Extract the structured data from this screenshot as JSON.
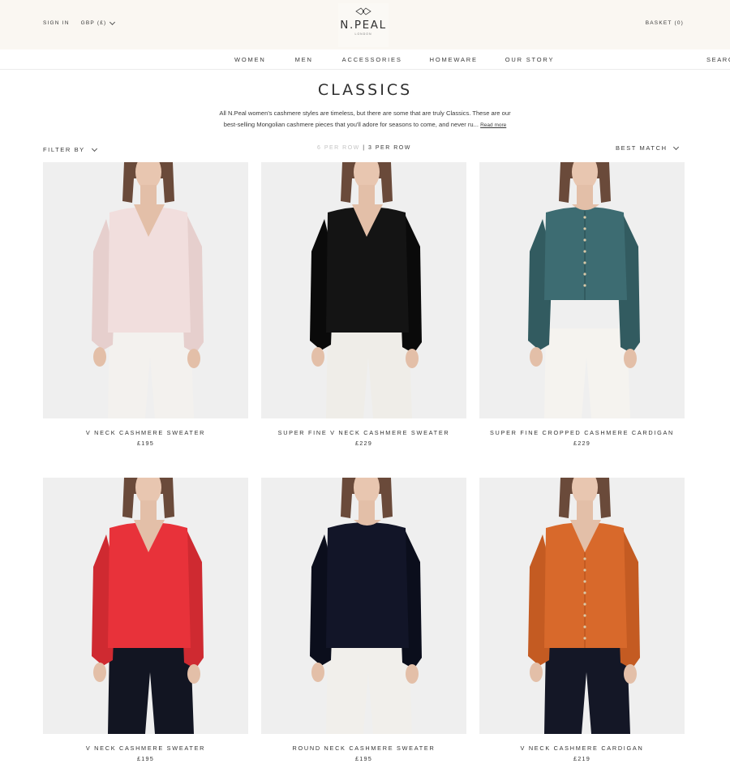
{
  "header": {
    "sign_in": "SIGN IN",
    "currency": "GBP (£)",
    "logo_name": "N.PEAL",
    "logo_sub": "LONDON",
    "basket": "BASKET (0)"
  },
  "nav": {
    "items": [
      "WOMEN",
      "MEN",
      "ACCESSORIES",
      "HOMEWARE",
      "OUR STORY"
    ],
    "search": "SEARC"
  },
  "page": {
    "title": "CLASSICS",
    "intro_line1": "All N.Peal women's cashmere styles are timeless, but there are some that are truly Classics. These are our",
    "intro_line2": "best-selling Mongolian cashmere pieces that you'll adore for seasons to come, and never ru...",
    "read_more": "Read more"
  },
  "controls": {
    "filter_label": "FILTER BY",
    "per_row_6": "6 PER ROW",
    "per_row_sep": "|",
    "per_row_3": "3 PER ROW",
    "sort_label": "BEST MATCH"
  },
  "products": [
    {
      "name": "V NECK CASHMERE SWEATER",
      "price": "£195",
      "top_color": "#f1dedd",
      "top_shade": "#e6cfcd",
      "bottom_color": "#f3f1ee",
      "neck": "v",
      "style": "sweater"
    },
    {
      "name": "SUPER FINE V NECK CASHMERE SWEATER",
      "price": "£229",
      "top_color": "#141414",
      "top_shade": "#0a0a0a",
      "bottom_color": "#efede8",
      "neck": "v",
      "style": "sweater"
    },
    {
      "name": "SUPER FINE CROPPED CASHMERE CARDIGAN",
      "price": "£229",
      "top_color": "#3d6c72",
      "top_shade": "#325b60",
      "bottom_color": "#f5f3ef",
      "neck": "round",
      "style": "cardigan"
    },
    {
      "name": "V NECK CASHMERE SWEATER",
      "price": "£195",
      "top_color": "#e8323a",
      "top_shade": "#cf2a31",
      "bottom_color": "#121522",
      "neck": "v",
      "style": "sweater"
    },
    {
      "name": "ROUND NECK CASHMERE SWEATER",
      "price": "£195",
      "top_color": "#121528",
      "top_shade": "#0b0e1c",
      "bottom_color": "#f1efeb",
      "neck": "round",
      "style": "sweater"
    },
    {
      "name": "V NECK CASHMERE CARDIGAN",
      "price": "£219",
      "top_color": "#d8692b",
      "top_shade": "#c45b22",
      "bottom_color": "#141726",
      "neck": "v",
      "style": "cardigan"
    }
  ]
}
